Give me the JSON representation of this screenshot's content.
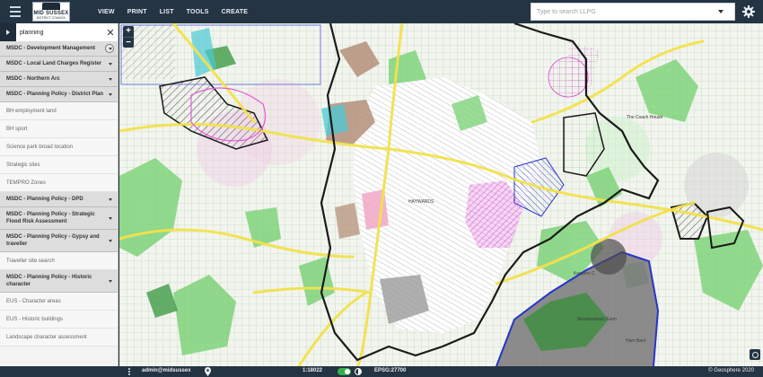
{
  "header": {
    "logo_line1": "MID SUSSEX",
    "logo_line2": "DISTRICT COUNCIL",
    "menu": [
      "VIEW",
      "PRINT",
      "LIST",
      "TOOLS",
      "CREATE"
    ],
    "search_placeholder": "Type to search LLPG"
  },
  "sidebar": {
    "search_value": "planning",
    "g1": "MSDC - Development Management",
    "g2": "MSDC - Local Land Charges Register",
    "g3": "MSDC - Northern Arc",
    "g4": "MSDC - Planning Policy - District Plan",
    "g4_layers": [
      "BH employment land",
      "BH sport",
      "Science park broad location",
      "Strategic sites",
      "TEMPRO Zones"
    ],
    "g5": "MSDC - Planning Policy - DPD",
    "g6": "MSDC - Planning Policy - Strategic Flood Risk Assessment",
    "g7": "MSDC - Planning Policy - Gypsy and traveller",
    "g7_layers": [
      "Traveller site search"
    ],
    "g8": "MSDC - Planning Policy - Historic character",
    "g8_layers": [
      "EUS - Character areas",
      "EUS - Historic buildings",
      "Landscape character assessment"
    ]
  },
  "map": {
    "zoom_in": "+",
    "zoom_out": "−",
    "labels": {
      "haywards": "HAYWARDS",
      "keepers": "Keepers C",
      "meadowlands": "Meadowlands Farm",
      "ham_barn": "Ham Barn",
      "coach_house": "The Coach House"
    }
  },
  "status": {
    "user": "admin@midsussex",
    "scale": "1:18022",
    "epsg": "EPSG:27700",
    "copyright": "© Geosphere 2020"
  },
  "colors": {
    "header": "#253443",
    "boundary": "#1a1a1a",
    "road": "#f2e24c",
    "green": "#7ed37a",
    "magenta": "#e05cd6",
    "blue_boundary": "#2733c9"
  }
}
